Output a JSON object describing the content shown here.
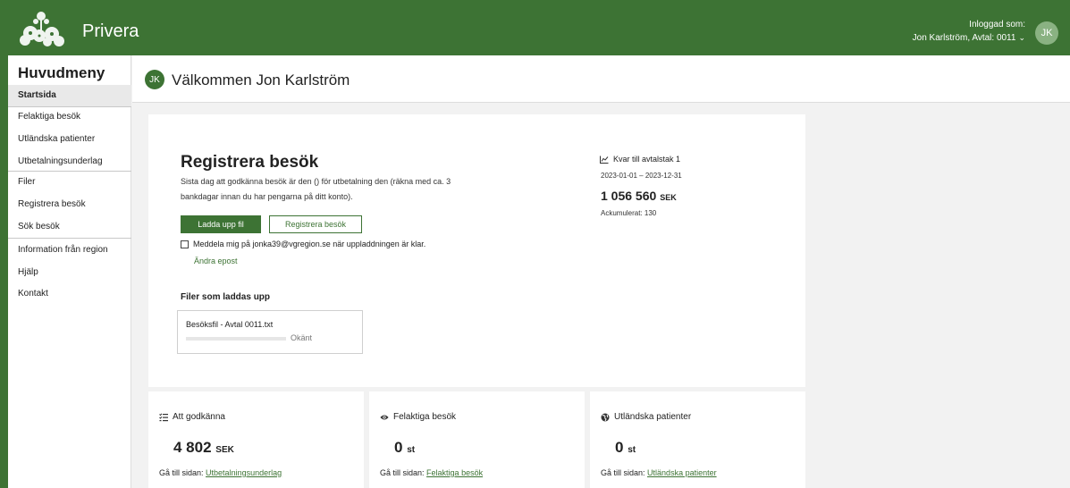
{
  "header": {
    "brand": "Privera",
    "logged_in_label": "Inloggad som:",
    "user_line": "Jon Karlström, Avtal: 0011",
    "avatar_initials": "JK"
  },
  "sidebar": {
    "title": "Huvudmeny",
    "items": [
      {
        "label": "Startsida",
        "active": true
      },
      {
        "label": "Felaktiga besök"
      },
      {
        "label": "Utländska patienter"
      },
      {
        "label": "Utbetalningsunderlag"
      },
      {
        "label": "Filer"
      },
      {
        "label": "Registrera besök"
      },
      {
        "label": "Sök besök"
      },
      {
        "label": "Information från region"
      },
      {
        "label": "Hjälp"
      },
      {
        "label": "Kontakt"
      }
    ]
  },
  "welcome": {
    "avatar_initials": "JK",
    "text": "Välkommen Jon Karlström"
  },
  "register": {
    "title": "Registrera besök",
    "description": "Sista dag att godkänna besök är den () för utbetalning den (räkna med ca. 3 bankdagar innan du har pengarna på ditt konto).",
    "upload_button": "Ladda upp fil",
    "register_button": "Registrera besök",
    "notify_text": "Meddela mig på jonka39@vgregion.se när uppladdningen är klar.",
    "change_email": "Ändra epost",
    "files_title": "Filer som laddas upp",
    "file": {
      "name": "Besöksfil - Avtal 0011.txt",
      "status": "Okänt",
      "progress": 0
    }
  },
  "limit": {
    "title": "Kvar till avtalstak 1",
    "range": "2023-01-01 – 2023-12-31",
    "amount": "1 056 560",
    "unit": "SEK",
    "accumulated": "Ackumulerat: 130"
  },
  "summary_cards": [
    {
      "icon": "list-check-icon",
      "title": "Att godkänna",
      "value": "4 802",
      "unit": "SEK",
      "link_prefix": "Gå till sidan:",
      "link_label": "Utbetalningsunderlag"
    },
    {
      "icon": "eye-icon",
      "title": "Felaktiga besök",
      "value": "0",
      "unit": "st",
      "link_prefix": "Gå till sidan:",
      "link_label": "Felaktiga besök"
    },
    {
      "icon": "globe-icon",
      "title": "Utländska patienter",
      "value": "0",
      "unit": "st",
      "link_prefix": "Gå till sidan:",
      "link_label": "Utländska patienter"
    }
  ],
  "colors": {
    "brand_green": "#3d7334",
    "background": "#f2f2f2"
  }
}
